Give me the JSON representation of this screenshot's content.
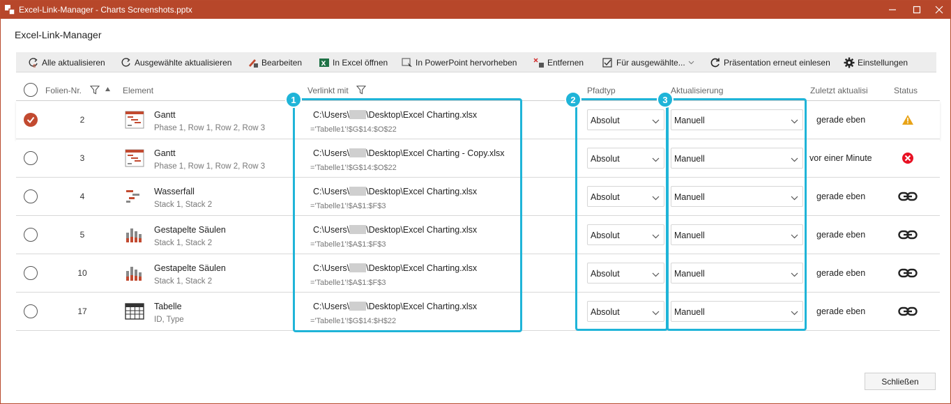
{
  "window": {
    "title": "Excel-Link-Manager - Charts Screenshots.pptx"
  },
  "app_heading": "Excel-Link-Manager",
  "toolbar": [
    {
      "label": "Alle aktualisieren",
      "icon": "refresh-all-icon"
    },
    {
      "label": "Ausgewählte aktualisieren",
      "icon": "refresh-icon"
    },
    {
      "label": "Bearbeiten",
      "icon": "edit-excel-icon"
    },
    {
      "label": "In Excel öffnen",
      "icon": "excel-icon"
    },
    {
      "label": "In PowerPoint hervorheben",
      "icon": "highlight-icon"
    },
    {
      "label": "Entfernen",
      "icon": "remove-icon"
    },
    {
      "label": "Für ausgewählte...",
      "icon": "checklist-icon"
    },
    {
      "label": "Präsentation erneut einlesen",
      "icon": "reload-icon"
    },
    {
      "label": "Einstellungen",
      "icon": "gear-icon"
    }
  ],
  "columns": {
    "slide_no": "Folien-Nr.",
    "element": "Element",
    "linked_with": "Verlinkt mit",
    "path_type": "Pfadtyp",
    "update": "Aktualisierung",
    "last_updated": "Zuletzt aktualisi",
    "status": "Status"
  },
  "rows": [
    {
      "checked": true,
      "slide": "2",
      "element": "Gantt",
      "sub": "Phase 1, Row 1, Row 2, Row 3",
      "icon": "gantt-icon",
      "path_pre": "C:\\Users\\",
      "path_post": "\\Desktop\\Excel Charting.xlsx",
      "range": "='Tabelle1'!$G$14:$O$22",
      "path_type": "Absolut",
      "update": "Manuell",
      "last_updated": "gerade eben",
      "status": "warning-icon"
    },
    {
      "checked": false,
      "slide": "3",
      "element": "Gantt",
      "sub": "Phase 1, Row 1, Row 2, Row 3",
      "icon": "gantt-icon",
      "path_pre": "C:\\Users\\",
      "path_post": "\\Desktop\\Excel Charting - Copy.xlsx",
      "range": "='Tabelle1'!$G$14:$O$22",
      "path_type": "Absolut",
      "update": "Manuell",
      "last_updated": "vor einer Minute",
      "status": "error-icon"
    },
    {
      "checked": false,
      "slide": "4",
      "element": "Wasserfall",
      "sub": "Stack 1, Stack 2",
      "icon": "waterfall-icon",
      "path_pre": "C:\\Users\\",
      "path_post": "\\Desktop\\Excel Charting.xlsx",
      "range": "='Tabelle1'!$A$1:$F$3",
      "path_type": "Absolut",
      "update": "Manuell",
      "last_updated": "gerade eben",
      "status": "link-icon"
    },
    {
      "checked": false,
      "slide": "5",
      "element": "Gestapelte Säulen",
      "sub": "Stack 1, Stack 2",
      "icon": "stacked-column-icon",
      "path_pre": "C:\\Users\\",
      "path_post": "\\Desktop\\Excel Charting.xlsx",
      "range": "='Tabelle1'!$A$1:$F$3",
      "path_type": "Absolut",
      "update": "Manuell",
      "last_updated": "gerade eben",
      "status": "link-icon"
    },
    {
      "checked": false,
      "slide": "10",
      "element": "Gestapelte Säulen",
      "sub": "Stack 1, Stack 2",
      "icon": "stacked-column-icon",
      "path_pre": "C:\\Users\\",
      "path_post": "\\Desktop\\Excel Charting.xlsx",
      "range": "='Tabelle1'!$A$1:$F$3",
      "path_type": "Absolut",
      "update": "Manuell",
      "last_updated": "gerade eben",
      "status": "link-icon"
    },
    {
      "checked": false,
      "slide": "17",
      "element": "Tabelle",
      "sub": "ID, Type",
      "icon": "table-icon",
      "path_pre": "C:\\Users\\",
      "path_post": "\\Desktop\\Excel Charting.xlsx",
      "range": "='Tabelle1'!$G$14:$H$22",
      "path_type": "Absolut",
      "update": "Manuell",
      "last_updated": "gerade eben",
      "status": "link-icon"
    }
  ],
  "callouts": [
    "1",
    "2",
    "3"
  ],
  "footer": {
    "close_label": "Schließen"
  },
  "colors": {
    "titlebar": "#b7472a",
    "accent": "#c24a30",
    "callout": "#1fb4d8"
  }
}
